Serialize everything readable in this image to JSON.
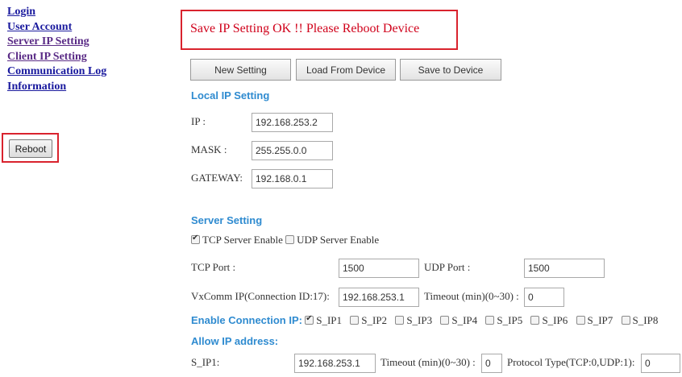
{
  "nav": {
    "items": [
      {
        "label": "Login",
        "visited": false
      },
      {
        "label": "User Account",
        "visited": false
      },
      {
        "label": "Server IP Setting",
        "visited": true
      },
      {
        "label": "Client IP Setting",
        "visited": true
      },
      {
        "label": "Communication Log",
        "visited": false
      },
      {
        "label": "Information",
        "visited": false
      }
    ],
    "reboot_label": "Reboot"
  },
  "status_message": "Save IP Setting OK !! Please Reboot Device",
  "toolbar": {
    "new_setting": "New Setting",
    "load_from_device": "Load From Device",
    "save_to_device": "Save to Device"
  },
  "local_ip": {
    "title": "Local IP Setting",
    "ip_label": "IP :",
    "ip_value": "192.168.253.2",
    "mask_label": "MASK :",
    "mask_value": "255.255.0.0",
    "gateway_label": "GATEWAY:",
    "gateway_value": "192.168.0.1"
  },
  "server": {
    "title": "Server Setting",
    "tcp_enable_label": "TCP Server Enable",
    "tcp_enable_checked": true,
    "udp_enable_label": "UDP Server Enable",
    "udp_enable_checked": false,
    "tcp_port_label": "TCP Port :",
    "tcp_port_value": "1500",
    "udp_port_label": "UDP Port :",
    "udp_port_value": "1500",
    "vxcomm_label": "VxComm IP(Connection ID:17):",
    "vxcomm_value": "192.168.253.1",
    "timeout_label": "Timeout (min)(0~30) :",
    "timeout_value": "0"
  },
  "enable_connection": {
    "label": "Enable Connection IP:",
    "items": [
      {
        "label": "S_IP1",
        "checked": true
      },
      {
        "label": "S_IP2",
        "checked": false
      },
      {
        "label": "S_IP3",
        "checked": false
      },
      {
        "label": "S_IP4",
        "checked": false
      },
      {
        "label": "S_IP5",
        "checked": false
      },
      {
        "label": "S_IP6",
        "checked": false
      },
      {
        "label": "S_IP7",
        "checked": false
      },
      {
        "label": "S_IP8",
        "checked": false
      }
    ]
  },
  "allow_ip": {
    "title": "Allow IP address:",
    "sip1_label": "S_IP1:",
    "sip1_value": "192.168.253.1",
    "timeout_label": "Timeout (min)(0~30) :",
    "timeout_value": "0",
    "protocol_label": "Protocol Type(TCP:0,UDP:1):",
    "protocol_value": "0"
  }
}
